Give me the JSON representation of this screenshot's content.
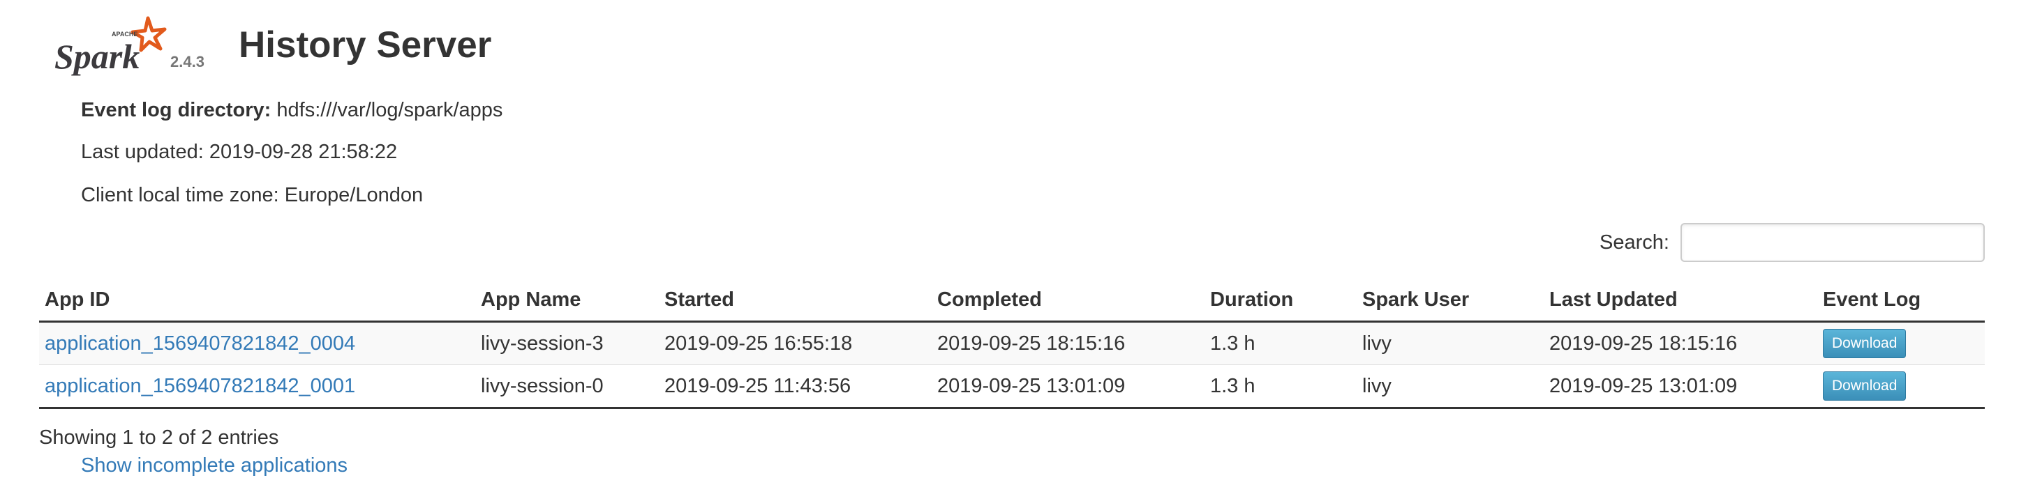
{
  "header": {
    "logo_brand": "Spark",
    "logo_apache": "APACHE",
    "version": "2.4.3",
    "title": "History Server"
  },
  "info": {
    "event_log_label": "Event log directory:",
    "event_log_value": "hdfs:///var/log/spark/apps",
    "last_updated": "Last updated: 2019-09-28 21:58:22",
    "timezone": "Client local time zone: Europe/London"
  },
  "search": {
    "label": "Search:",
    "value": "",
    "placeholder": ""
  },
  "table": {
    "columns": [
      "App ID",
      "App Name",
      "Started",
      "Completed",
      "Duration",
      "Spark User",
      "Last Updated",
      "Event Log"
    ],
    "rows": [
      {
        "app_id": "application_1569407821842_0004",
        "app_name": "livy-session-3",
        "started": "2019-09-25 16:55:18",
        "completed": "2019-09-25 18:15:16",
        "duration": "1.3 h",
        "user": "livy",
        "last_updated": "2019-09-25 18:15:16",
        "event_log": "Download"
      },
      {
        "app_id": "application_1569407821842_0001",
        "app_name": "livy-session-0",
        "started": "2019-09-25 11:43:56",
        "completed": "2019-09-25 13:01:09",
        "duration": "1.3 h",
        "user": "livy",
        "last_updated": "2019-09-25 13:01:09",
        "event_log": "Download"
      }
    ]
  },
  "footer": {
    "showing": "Showing 1 to 2 of 2 entries",
    "incomplete_link": "Show incomplete applications"
  },
  "colors": {
    "link": "#337ab7",
    "button": "#4aa0c8",
    "logo_orange": "#e25a1c"
  },
  "icons": [
    "spark-logo-icon"
  ]
}
